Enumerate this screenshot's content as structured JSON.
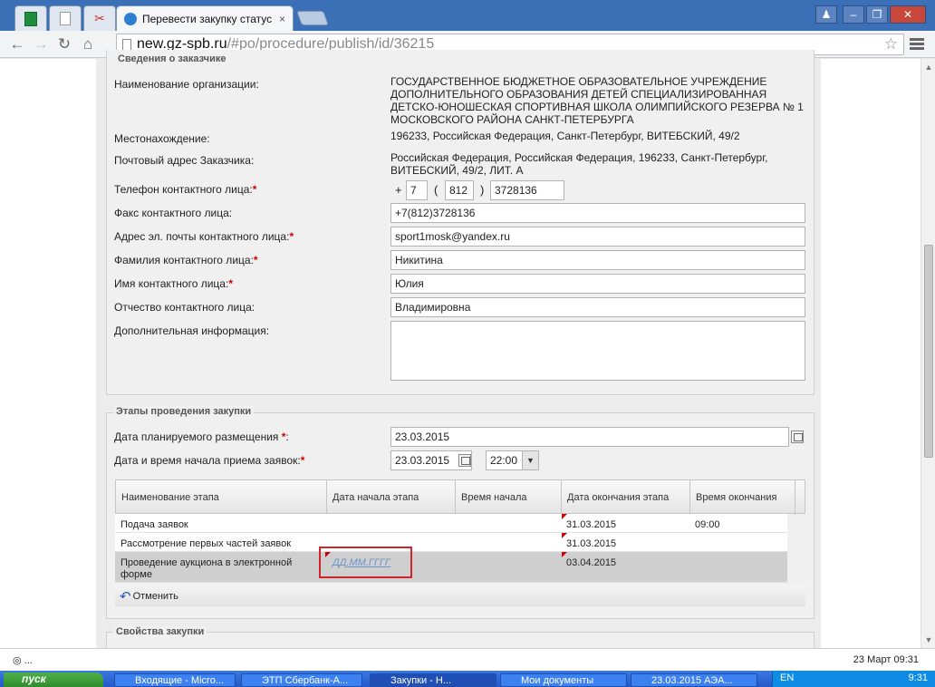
{
  "browser": {
    "tab_title": "Перевести закупку статус",
    "tab_close": "×",
    "url_host": "new.gz-spb.ru",
    "url_path": "/#po/procedure/publish/id/36215"
  },
  "customer": {
    "legend": "Сведения о заказчике",
    "org_name_label": "Наименование организации:",
    "org_name": "ГОСУДАРСТВЕННОЕ БЮДЖЕТНОЕ ОБРАЗОВАТЕЛЬНОЕ УЧРЕЖДЕНИЕ ДОПОЛНИТЕЛЬНОГО ОБРАЗОВАНИЯ ДЕТЕЙ СПЕЦИАЛИЗИРОВАННАЯ ДЕТСКО-ЮНОШЕСКАЯ СПОРТИВНАЯ ШКОЛА ОЛИМПИЙСКОГО РЕЗЕРВА № 1 МОСКОВСКОГО РАЙОНА САНКТ-ПЕТЕРБУРГА",
    "location_label": "Местонахождение:",
    "location": "196233, Российская Федерация, Санкт-Петербург, ВИТЕБСКИЙ, 49/2",
    "postal_label": "Почтовый адрес Заказчика:",
    "postal": "Российская Федерация, Российская Федерация, 196233, Санкт-Петербург, ВИТЕБСКИЙ, 49/2, ЛИТ. А",
    "phone_label": "Телефон контактного лица:",
    "phone_plus": "+",
    "phone_country": "7",
    "phone_lparen": "(",
    "phone_code": "812",
    "phone_rparen": ")",
    "phone_number": "3728136",
    "fax_label": "Факс контактного лица:",
    "fax": "+7(812)3728136",
    "email_label": "Адрес эл. почты контактного лица:",
    "email": "sport1mosk@yandex.ru",
    "lastname_label": "Фамилия контактного лица:",
    "lastname": "Никитина",
    "firstname_label": "Имя контактного лица:",
    "firstname": "Юлия",
    "patronymic_label": "Отчество контактного лица:",
    "patronymic": "Владимировна",
    "additional_label": "Дополнительная информация:",
    "additional": "",
    "required_mark": "*"
  },
  "stages": {
    "legend": "Этапы проведения закупки",
    "planned_date_label": "Дата планируемого размещения ",
    "planned_date_colon": ":",
    "planned_date": "23.03.2015",
    "start_label": "Дата и время начала приема заявок:",
    "start_date": "23.03.2015",
    "start_time": "22:00",
    "columns": [
      "Наименование этапа",
      "Дата начала этапа",
      "Время начала",
      "Дата окончания этапа",
      "Время окончания"
    ],
    "rows": [
      {
        "name": "Подача заявок",
        "start_date": "",
        "start_time": "",
        "end_date": "31.03.2015",
        "end_time": "09:00"
      },
      {
        "name": "Рассмотрение первых частей заявок",
        "start_date": "",
        "start_time": "",
        "end_date": "31.03.2015",
        "end_time": ""
      },
      {
        "name": "Проведение аукциона в электронной форме",
        "start_date": "ДД.ММ.ГГГГ",
        "start_time": "",
        "end_date": "03.04.2015",
        "end_time": ""
      }
    ],
    "cancel_label": "Отменить"
  },
  "properties": {
    "legend": "Свойства закупки"
  },
  "status": {
    "left": "◎ ...",
    "right": "23 Март 09:31"
  },
  "taskbar": {
    "start": "пуск",
    "tasks": [
      "Входящие - Micro...",
      "ЭТП Сбербанк-А...",
      "Закупки - Н...",
      "Мои документы",
      "23.03.2015 АЭА..."
    ],
    "lang": "EN",
    "clock": "9:31"
  }
}
